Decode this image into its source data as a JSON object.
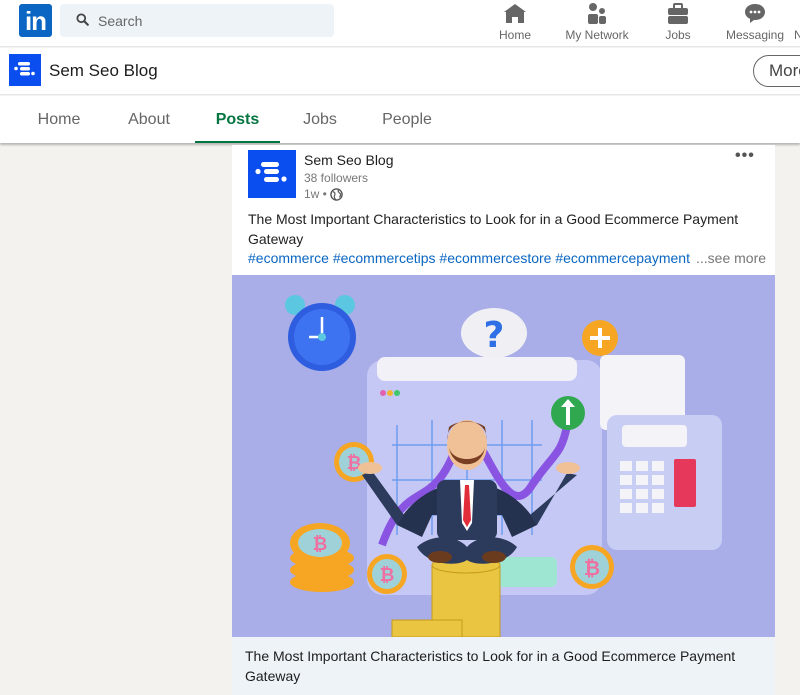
{
  "global_nav": {
    "logo": "in",
    "search": {
      "placeholder": "Search",
      "value": ""
    },
    "items": [
      {
        "label": "Home",
        "icon": "home-icon"
      },
      {
        "label": "My Network",
        "icon": "network-icon"
      },
      {
        "label": "Jobs",
        "icon": "briefcase-icon"
      },
      {
        "label": "Messaging",
        "icon": "message-icon"
      },
      {
        "label": "N",
        "icon": "notifications-icon"
      }
    ]
  },
  "company": {
    "name": "Sem Seo Blog",
    "more_label": "More"
  },
  "tabs": [
    {
      "label": "Home",
      "active": false
    },
    {
      "label": "About",
      "active": false
    },
    {
      "label": "Posts",
      "active": true
    },
    {
      "label": "Jobs",
      "active": false
    },
    {
      "label": "People",
      "active": false
    }
  ],
  "post": {
    "author": "Sem Seo Blog",
    "followers": "38 followers",
    "time": "1w •",
    "visibility_icon": "globe-icon",
    "menu": "•••",
    "text": "The Most Important Characteristics to Look for in a Good Ecommerce Payment Gateway",
    "hashtags": [
      "#ecommerce",
      "#ecommercetips",
      "#ecommercestore",
      "#ecommercepayment"
    ],
    "see_more": "...see more",
    "image_alt": "Illustration of businessman meditating on stack of coins with alarm clock, question bubble, chart, bitcoin coins and calculator",
    "caption": "The Most Important Characteristics to Look for in a Good Ecommerce Payment Gateway"
  },
  "colors": {
    "linkedin_blue": "#0a66c2",
    "brand_blue": "#0b4ef0",
    "active_tab_green": "#057642",
    "page_bg": "#f3f2ef",
    "image_bg": "#a9ade8"
  }
}
